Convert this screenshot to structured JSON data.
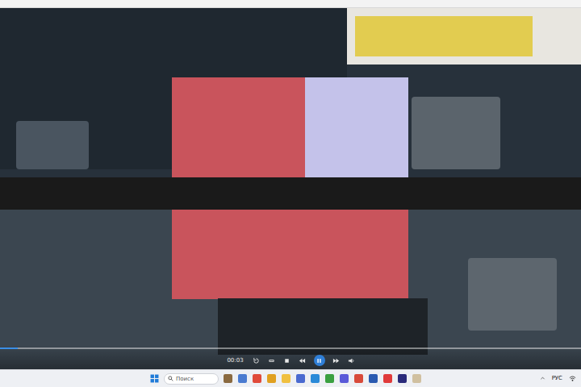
{
  "player": {
    "time": "00:03",
    "playing": true,
    "progress": {
      "level": 0.03
    }
  },
  "taskbar": {
    "search": {
      "placeholder": "Поиск"
    },
    "language": "РУС"
  }
}
